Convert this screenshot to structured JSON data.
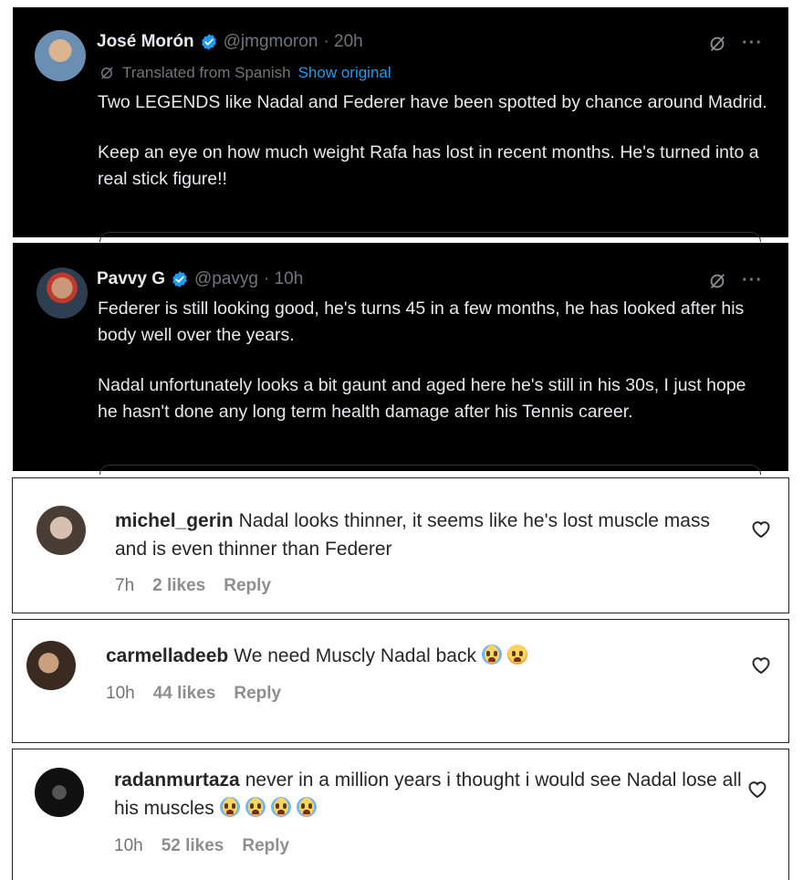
{
  "tweets": [
    {
      "name": "José Morón",
      "handle": "@jmgmoron",
      "time": "· 20h",
      "translated_label": "Translated from Spanish",
      "show_original": "Show original",
      "paragraphs": [
        "Two LEGENDS like Nadal and Federer have been spotted by chance around Madrid.",
        "Keep an eye on how much weight Rafa has lost in recent months. He's turned into a real stick figure!!"
      ]
    },
    {
      "name": "Pavvy G",
      "handle": "@pavyg",
      "time": "· 10h",
      "paragraphs": [
        "Federer is still looking good, he's turns 45 in a few months, he has looked after his body well over the years.",
        "Nadal unfortunately looks a bit gaunt and aged here he's still in his 30s, I just hope he hasn't done any long term health damage after his Tennis career."
      ]
    }
  ],
  "comments": [
    {
      "username": "michel_gerin",
      "text": "Nadal looks thinner, it seems like he's lost muscle mass and is even thinner than Federer",
      "time": "7h",
      "likes": "2 likes",
      "reply": "Reply"
    },
    {
      "username": "carmelladeeb",
      "text": "We need Muscly Nadal back",
      "emojis": [
        "crying-face-emoji",
        "pleading-face-emoji"
      ],
      "time": "10h",
      "likes": "44 likes",
      "reply": "Reply"
    },
    {
      "username": "radanmurtaza",
      "text": "never in a million years i thought i would see Nadal lose all his muscles",
      "emojis": [
        "crying-face-emoji",
        "crying-face-emoji",
        "crying-face-emoji",
        "crying-face-emoji"
      ],
      "time": "10h",
      "likes": "52 likes",
      "reply": "Reply"
    }
  ],
  "colors": {
    "tweet_bg": "#000000",
    "tweet_text": "#e7e9ea",
    "tweet_muted": "#71767b",
    "link_blue": "#1d9bf0",
    "verified_blue": "#1d9bf0",
    "comment_text": "#262626",
    "comment_muted": "#737373"
  },
  "icons": {
    "verified": "verified-badge-icon",
    "grok": "grok-icon",
    "more": "more-icon",
    "heart": "heart-icon",
    "translate": "translate-icon"
  }
}
